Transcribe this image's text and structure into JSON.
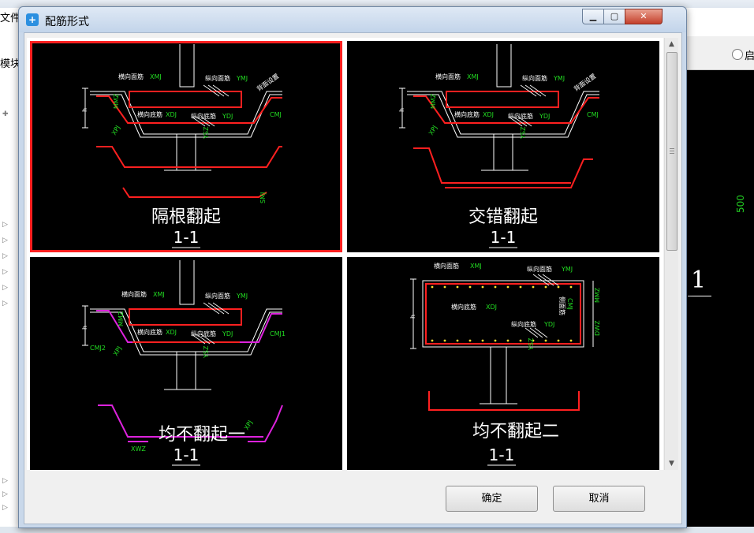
{
  "background": {
    "left_menu": [
      "文件",
      "模块导"
    ],
    "radio_label": "启",
    "canvas_dimension": "500",
    "canvas_label": "1"
  },
  "dialog": {
    "title": "配筋形式",
    "buttons": {
      "ok": "确定",
      "cancel": "取消"
    },
    "panels": [
      {
        "caption": "隔根翻起",
        "section": "1-1",
        "selected": true,
        "labels": {
          "a": "横向面筋",
          "a_code": "XMJ",
          "b": "纵向面筋",
          "b_code": "YMJ",
          "c": "横向底筋",
          "c_code": "XDJ",
          "d": "纵向底筋",
          "d_code": "YDJ",
          "e": "CMJ",
          "f": "背面设置",
          "g": "MMZ",
          "h": "XPJ",
          "i": "YSZ",
          "j": "h",
          "k": "SMJ"
        }
      },
      {
        "caption": "交错翻起",
        "section": "1-1",
        "selected": false,
        "labels": {
          "a": "横向面筋",
          "a_code": "XMJ",
          "b": "纵向面筋",
          "b_code": "YMJ",
          "c": "横向底筋",
          "c_code": "XDJ",
          "d": "纵向底筋",
          "d_code": "YDJ",
          "e": "CMJ",
          "f": "背面设置",
          "g": "MMZ",
          "h": "XPJ",
          "i": "YSZ",
          "j": "h"
        }
      },
      {
        "caption": "均不翻起一",
        "section": "1-1",
        "selected": false,
        "labels": {
          "a": "横向面筋",
          "a_code": "XMJ",
          "b": "纵向面筋",
          "b_code": "YMJ",
          "c": "横向底筋",
          "c_code": "XDJ",
          "d": "纵向底筋",
          "d_code": "YDJ",
          "e": "CMJ1",
          "f": "CMJ2",
          "g": "MMZ",
          "h": "XPJ",
          "i": "YSZ",
          "j": "h",
          "k": "XWZ",
          "l": "XPJ"
        }
      },
      {
        "caption": "均不翻起二",
        "section": "1-1",
        "selected": false,
        "labels": {
          "a": "横向面筋",
          "a_code": "XMJ",
          "b": "纵向面筋",
          "b_code": "YMJ",
          "c": "横向底筋",
          "c_code": "XDJ",
          "d": "纵向底筋",
          "d_code": "YDJ",
          "e": "侧面筋",
          "e_code": "CMJ",
          "g": "MMZ",
          "h": "DWZ",
          "i": "YSZ",
          "j": "h"
        }
      }
    ]
  }
}
